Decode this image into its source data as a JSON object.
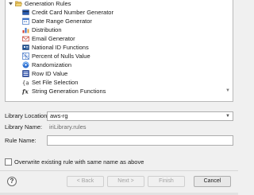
{
  "tree": {
    "root": {
      "label": "Generation Rules",
      "icon": "folder-open-icon"
    },
    "items": [
      {
        "label": "Credit Card Number Generator",
        "icon": "credit-card-icon"
      },
      {
        "label": "Date Range Generator",
        "icon": "calendar-icon"
      },
      {
        "label": "Distribution",
        "icon": "distribution-icon"
      },
      {
        "label": "Email Generator",
        "icon": "email-icon"
      },
      {
        "label": "National ID Functions",
        "icon": "id-card-icon"
      },
      {
        "label": "Percent of Nulls Value",
        "icon": "percent-icon"
      },
      {
        "label": "Randomization",
        "icon": "randomization-icon"
      },
      {
        "label": "Row ID Value",
        "icon": "row-id-icon"
      },
      {
        "label": "Set File Selection",
        "icon": "set-file-icon"
      },
      {
        "label": "String Generation Functions",
        "icon": "function-icon"
      }
    ]
  },
  "form": {
    "library_location_label": "Library Location:",
    "library_location_value": "aws-rg",
    "library_name_label": "Library Name:",
    "library_name_value": "iriLibrary.rules",
    "rule_name_label": "Rule Name:",
    "rule_name_value": "",
    "overwrite_label": "Overwrite existing rule with same name as above",
    "overwrite_checked": false
  },
  "buttons": {
    "help": "?",
    "back": "< Back",
    "next": "Next >",
    "finish": "Finish",
    "cancel": "Cancel"
  }
}
